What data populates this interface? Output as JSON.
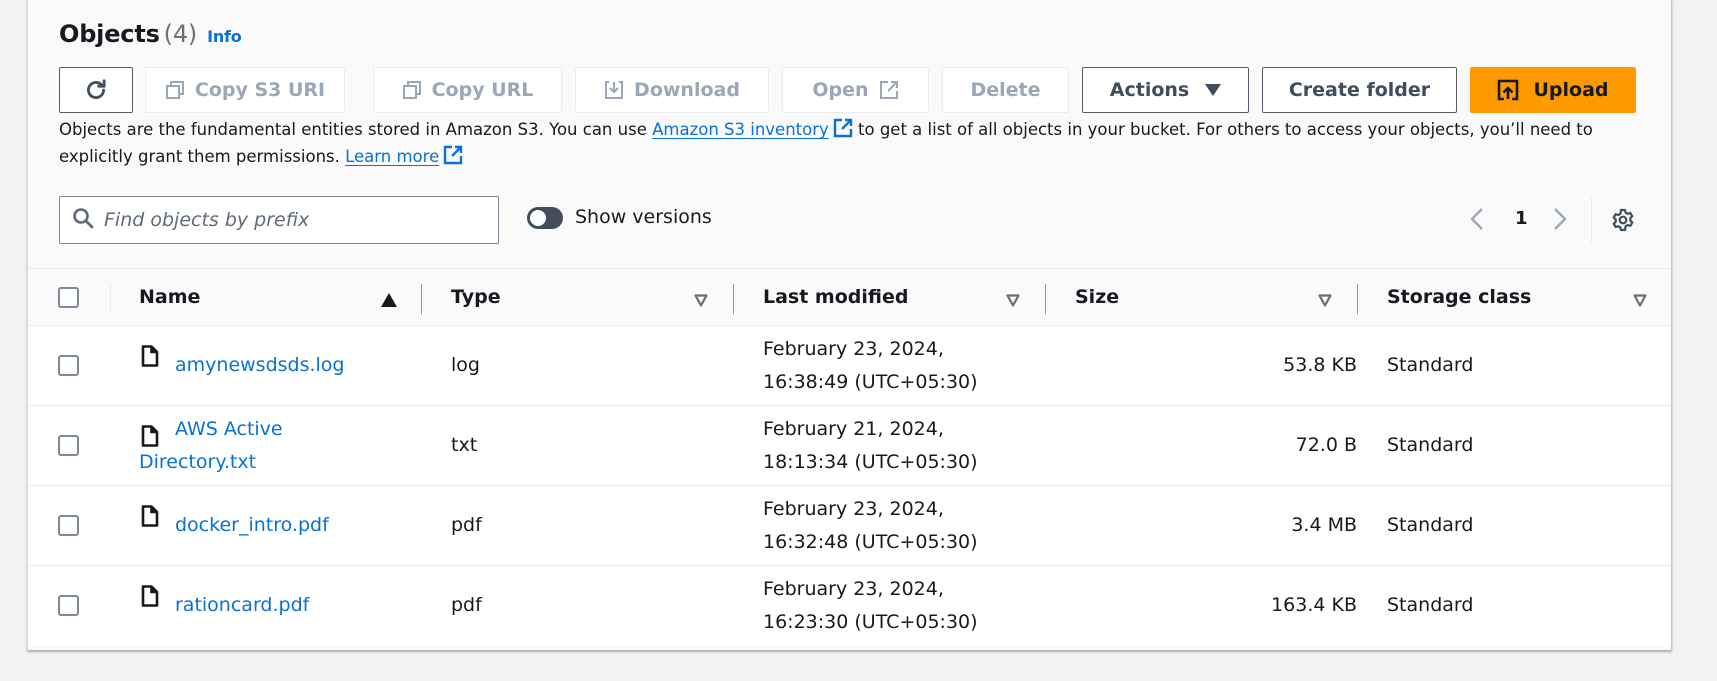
{
  "header": {
    "title": "Objects",
    "count": "(4)",
    "info_link": "Info"
  },
  "toolbar": {
    "refresh_icon": "refresh-icon",
    "copy_s3_uri": "Copy S3 URI",
    "copy_url": "Copy URL",
    "download": "Download",
    "open": "Open",
    "delete": "Delete",
    "actions": "Actions",
    "create_folder": "Create folder",
    "upload": "Upload",
    "colors": {
      "primary": "#ff9900",
      "disabled_text": "#9ba7b6",
      "link": "#0972d3"
    }
  },
  "description": {
    "part1": "Objects are the fundamental entities stored in Amazon S3. You can use ",
    "inventory_link": "Amazon S3 inventory",
    "part2": " to get a list of all objects in your bucket. For others to access your objects, you’ll need to explicitly grant them permissions. ",
    "learn_more": "Learn more"
  },
  "search": {
    "placeholder": "Find objects by prefix",
    "value": ""
  },
  "versions_toggle": {
    "label": "Show versions",
    "checked": false
  },
  "pagination": {
    "current_page": "1"
  },
  "table": {
    "columns": [
      {
        "label": "Name",
        "sort": "ascending"
      },
      {
        "label": "Type",
        "sort": "none"
      },
      {
        "label": "Last modified",
        "sort": "none"
      },
      {
        "label": "Size",
        "sort": "none"
      },
      {
        "label": "Storage class",
        "sort": "none"
      }
    ],
    "rows": [
      {
        "name_line1": "amynewsdsds.log",
        "name_line2": "",
        "type": "log",
        "modified_line1": "February 23, 2024,",
        "modified_line2": "16:38:49 (UTC+05:30)",
        "size": "53.8 KB",
        "storage_class": "Standard"
      },
      {
        "name_line1": "AWS Active",
        "name_line2": "Directory.txt",
        "type": "txt",
        "modified_line1": "February 21, 2024,",
        "modified_line2": "18:13:34 (UTC+05:30)",
        "size": "72.0 B",
        "storage_class": "Standard"
      },
      {
        "name_line1": "docker_intro.pdf",
        "name_line2": "",
        "type": "pdf",
        "modified_line1": "February 23, 2024,",
        "modified_line2": "16:32:48 (UTC+05:30)",
        "size": "3.4 MB",
        "storage_class": "Standard"
      },
      {
        "name_line1": "rationcard.pdf",
        "name_line2": "",
        "type": "pdf",
        "modified_line1": "February 23, 2024,",
        "modified_line2": "16:23:30 (UTC+05:30)",
        "size": "163.4 KB",
        "storage_class": "Standard"
      }
    ]
  }
}
